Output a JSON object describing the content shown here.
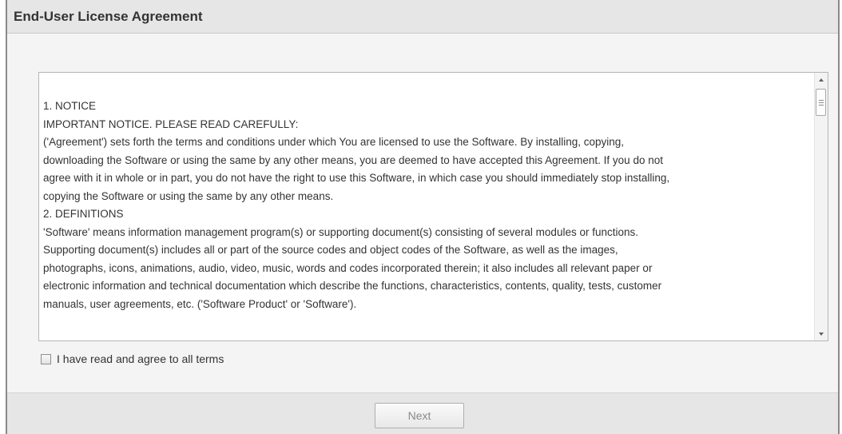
{
  "window": {
    "title": "End-User License Agreement"
  },
  "agreement": {
    "lines": [
      "1. NOTICE",
      "IMPORTANT NOTICE. PLEASE READ CAREFULLY:",
      "('Agreement') sets forth the terms and conditions under which You are licensed to use the Software. By installing, copying,",
      "downloading the Software or using the same by any other means, you are deemed to have accepted this Agreement. If you do not",
      "agree with it in whole or in part, you do not have the right to use this Software, in which case you should immediately stop installing,",
      "copying the Software or using the same by any other means.",
      "2. DEFINITIONS",
      "'Software' means information management program(s) or supporting document(s) consisting of several modules or functions.",
      "Supporting document(s) includes all or part of the source codes and object codes of the Software, as well as the images,",
      "photographs, icons, animations, audio, video, music, words and codes incorporated therein; it also includes all relevant paper or",
      "electronic information and technical documentation which describe the functions, characteristics, contents, quality, tests, customer",
      "manuals, user agreements, etc. ('Software Product' or 'Software')."
    ]
  },
  "agree_checkbox": {
    "label": "I have read and agree to all terms",
    "checked": false
  },
  "footer": {
    "next_label": "Next",
    "next_enabled": false
  }
}
